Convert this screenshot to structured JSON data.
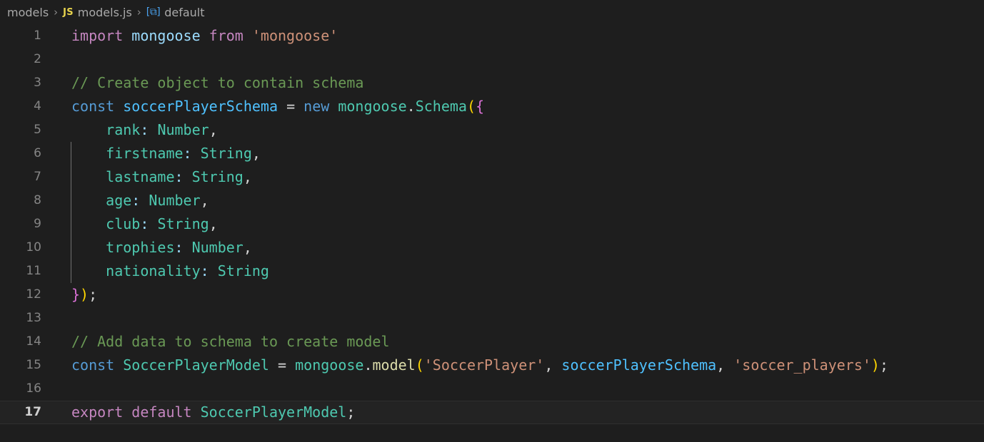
{
  "breadcrumb": {
    "folder": "models",
    "separator": "›",
    "file": "models.js",
    "file_icon_label": "JS",
    "symbol_icon_label": "[⧉]",
    "symbol": "default"
  },
  "editor": {
    "background_color": "#1e1e1e",
    "active_line_color": "#232323",
    "line_number_color": "#858585",
    "active_line_number_color": "#d0d0d0",
    "active_line": 17,
    "total_lines": 17,
    "language": "javascript",
    "colors": {
      "keyword": "#569cd6",
      "import_export": "#c586c0",
      "variable": "#9cdcfe",
      "variable_declaration": "#4fc1ff",
      "string": "#ce9178",
      "comment": "#6a9955",
      "type_class": "#4ec9b0",
      "function": "#dcdcaa",
      "plain": "#d4d4d4",
      "bracket_yellow": "#ffd700",
      "bracket_pink": "#da70d6",
      "bracket_blue": "#179fff"
    },
    "lines": [
      {
        "n": "1",
        "tokens": [
          {
            "t": "import",
            "c": "t-imp"
          },
          {
            "t": " ",
            "c": "t-plain"
          },
          {
            "t": "mongoose",
            "c": "t-var"
          },
          {
            "t": " ",
            "c": "t-plain"
          },
          {
            "t": "from",
            "c": "t-imp"
          },
          {
            "t": " ",
            "c": "t-plain"
          },
          {
            "t": "'mongoose'",
            "c": "t-str"
          }
        ]
      },
      {
        "n": "2",
        "tokens": []
      },
      {
        "n": "3",
        "tokens": [
          {
            "t": "// Create object to contain schema",
            "c": "t-cmt"
          }
        ]
      },
      {
        "n": "4",
        "tokens": [
          {
            "t": "const",
            "c": "t-kw"
          },
          {
            "t": " ",
            "c": "t-plain"
          },
          {
            "t": "soccerPlayerSchema",
            "c": "t-varb"
          },
          {
            "t": " ",
            "c": "t-plain"
          },
          {
            "t": "=",
            "c": "t-plain"
          },
          {
            "t": " ",
            "c": "t-plain"
          },
          {
            "t": "new",
            "c": "t-kw"
          },
          {
            "t": " ",
            "c": "t-plain"
          },
          {
            "t": "mongoose",
            "c": "t-type"
          },
          {
            "t": ".",
            "c": "t-plain"
          },
          {
            "t": "Schema",
            "c": "t-type"
          },
          {
            "t": "(",
            "c": "t-b-yellow"
          },
          {
            "t": "{",
            "c": "t-b-pink"
          }
        ]
      },
      {
        "n": "5",
        "tokens": [
          {
            "t": "    ",
            "c": "t-plain"
          },
          {
            "t": "rank",
            "c": "t-type"
          },
          {
            "t": ":",
            "c": "t-var"
          },
          {
            "t": " ",
            "c": "t-plain"
          },
          {
            "t": "Number",
            "c": "t-type"
          },
          {
            "t": ",",
            "c": "t-plain"
          }
        ]
      },
      {
        "n": "6",
        "tokens": [
          {
            "t": "    ",
            "c": "t-plain"
          },
          {
            "t": "firstname",
            "c": "t-type"
          },
          {
            "t": ":",
            "c": "t-var"
          },
          {
            "t": " ",
            "c": "t-plain"
          },
          {
            "t": "String",
            "c": "t-type"
          },
          {
            "t": ",",
            "c": "t-plain"
          }
        ]
      },
      {
        "n": "7",
        "tokens": [
          {
            "t": "    ",
            "c": "t-plain"
          },
          {
            "t": "lastname",
            "c": "t-type"
          },
          {
            "t": ":",
            "c": "t-var"
          },
          {
            "t": " ",
            "c": "t-plain"
          },
          {
            "t": "String",
            "c": "t-type"
          },
          {
            "t": ",",
            "c": "t-plain"
          }
        ]
      },
      {
        "n": "8",
        "tokens": [
          {
            "t": "    ",
            "c": "t-plain"
          },
          {
            "t": "age",
            "c": "t-type"
          },
          {
            "t": ":",
            "c": "t-var"
          },
          {
            "t": " ",
            "c": "t-plain"
          },
          {
            "t": "Number",
            "c": "t-type"
          },
          {
            "t": ",",
            "c": "t-plain"
          }
        ]
      },
      {
        "n": "9",
        "tokens": [
          {
            "t": "    ",
            "c": "t-plain"
          },
          {
            "t": "club",
            "c": "t-type"
          },
          {
            "t": ":",
            "c": "t-var"
          },
          {
            "t": " ",
            "c": "t-plain"
          },
          {
            "t": "String",
            "c": "t-type"
          },
          {
            "t": ",",
            "c": "t-plain"
          }
        ]
      },
      {
        "n": "10",
        "tokens": [
          {
            "t": "    ",
            "c": "t-plain"
          },
          {
            "t": "trophies",
            "c": "t-type"
          },
          {
            "t": ":",
            "c": "t-var"
          },
          {
            "t": " ",
            "c": "t-plain"
          },
          {
            "t": "Number",
            "c": "t-type"
          },
          {
            "t": ",",
            "c": "t-plain"
          }
        ]
      },
      {
        "n": "11",
        "tokens": [
          {
            "t": "    ",
            "c": "t-plain"
          },
          {
            "t": "nationality",
            "c": "t-type"
          },
          {
            "t": ":",
            "c": "t-var"
          },
          {
            "t": " ",
            "c": "t-plain"
          },
          {
            "t": "String",
            "c": "t-type"
          }
        ]
      },
      {
        "n": "12",
        "tokens": [
          {
            "t": "}",
            "c": "t-b-pink"
          },
          {
            "t": ")",
            "c": "t-b-yellow"
          },
          {
            "t": ";",
            "c": "t-plain"
          }
        ]
      },
      {
        "n": "13",
        "tokens": []
      },
      {
        "n": "14",
        "tokens": [
          {
            "t": "// Add data to schema to create model",
            "c": "t-cmt"
          }
        ]
      },
      {
        "n": "15",
        "tokens": [
          {
            "t": "const",
            "c": "t-kw"
          },
          {
            "t": " ",
            "c": "t-plain"
          },
          {
            "t": "SoccerPlayerModel",
            "c": "t-type"
          },
          {
            "t": " ",
            "c": "t-plain"
          },
          {
            "t": "=",
            "c": "t-plain"
          },
          {
            "t": " ",
            "c": "t-plain"
          },
          {
            "t": "mongoose",
            "c": "t-type"
          },
          {
            "t": ".",
            "c": "t-plain"
          },
          {
            "t": "model",
            "c": "t-fn"
          },
          {
            "t": "(",
            "c": "t-b-yellow"
          },
          {
            "t": "'SoccerPlayer'",
            "c": "t-str"
          },
          {
            "t": ",",
            "c": "t-plain"
          },
          {
            "t": " ",
            "c": "t-plain"
          },
          {
            "t": "soccerPlayerSchema",
            "c": "t-varb"
          },
          {
            "t": ",",
            "c": "t-plain"
          },
          {
            "t": " ",
            "c": "t-plain"
          },
          {
            "t": "'soccer_players'",
            "c": "t-str"
          },
          {
            "t": ")",
            "c": "t-b-yellow"
          },
          {
            "t": ";",
            "c": "t-plain"
          }
        ]
      },
      {
        "n": "16",
        "tokens": []
      },
      {
        "n": "17",
        "tokens": [
          {
            "t": "export",
            "c": "t-imp"
          },
          {
            "t": " ",
            "c": "t-plain"
          },
          {
            "t": "default",
            "c": "t-imp"
          },
          {
            "t": " ",
            "c": "t-plain"
          },
          {
            "t": "SoccerPlayerModel",
            "c": "t-type"
          },
          {
            "t": ";",
            "c": "t-plain"
          }
        ]
      }
    ]
  }
}
